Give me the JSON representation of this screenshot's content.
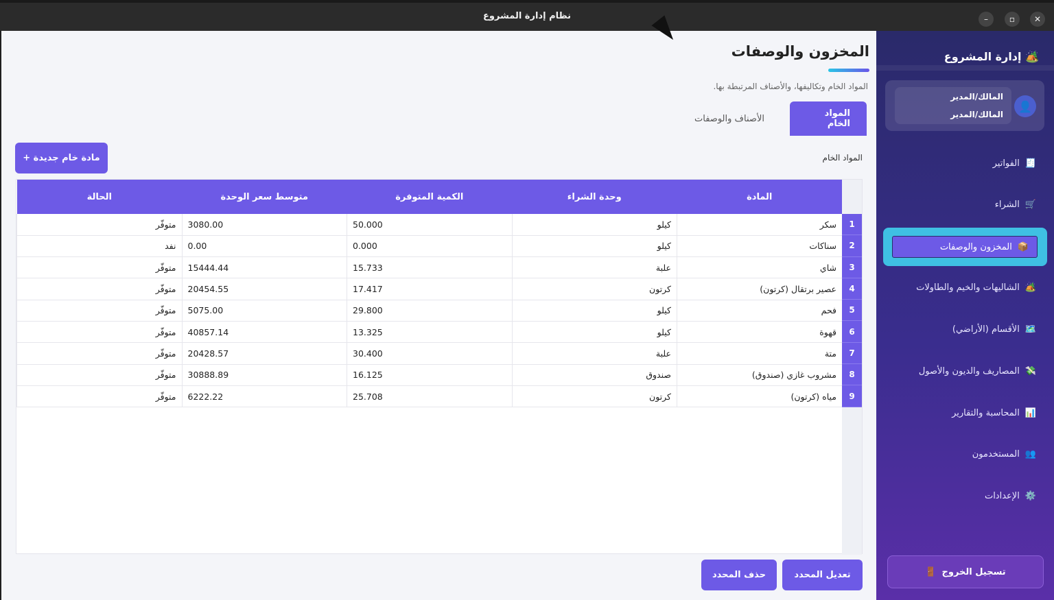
{
  "window": {
    "title": "نظام إدارة المشروع",
    "close": "✕",
    "maximize": "▫",
    "minimize": "–"
  },
  "page": {
    "title": "المخزون والوصفات",
    "subtitle": "المواد الخام وتكاليفها، والأصناف المرتبطة بها.",
    "tabs": [
      {
        "label": "المواد الخام",
        "active": true
      },
      {
        "label": "الأصناف والوصفات",
        "active": false
      }
    ],
    "section_label": "المواد الخام",
    "new_button": "مادة خام جديدة +",
    "edit_button": "تعديل المحدد",
    "delete_button": "حذف المحدد"
  },
  "table": {
    "headers": [
      "المادة",
      "وحدة الشراء",
      "الكمية المتوفرة",
      "متوسط سعر الوحدة",
      "الحالة"
    ],
    "rows": [
      {
        "index": "1",
        "name": "سكر",
        "unit": "كيلو",
        "qty": "50.000",
        "price": "3080.00",
        "status": "متوفّر"
      },
      {
        "index": "2",
        "name": "سناكات",
        "unit": "كيلو",
        "qty": "0.000",
        "price": "0.00",
        "status": "نفد"
      },
      {
        "index": "3",
        "name": "شاي",
        "unit": "علبة",
        "qty": "15.733",
        "price": "15444.44",
        "status": "متوفّر"
      },
      {
        "index": "4",
        "name": "عصير برتقال (كرتون)",
        "unit": "كرتون",
        "qty": "17.417",
        "price": "20454.55",
        "status": "متوفّر"
      },
      {
        "index": "5",
        "name": "فحم",
        "unit": "كيلو",
        "qty": "29.800",
        "price": "5075.00",
        "status": "متوفّر"
      },
      {
        "index": "6",
        "name": "قهوة",
        "unit": "كيلو",
        "qty": "13.325",
        "price": "40857.14",
        "status": "متوفّر"
      },
      {
        "index": "7",
        "name": "متة",
        "unit": "علبة",
        "qty": "30.400",
        "price": "20428.57",
        "status": "متوفّر"
      },
      {
        "index": "8",
        "name": "مشروب غازي (صندوق)",
        "unit": "صندوق",
        "qty": "16.125",
        "price": "30888.89",
        "status": "متوفّر"
      },
      {
        "index": "9",
        "name": "مياه (كرتون)",
        "unit": "كرتون",
        "qty": "25.708",
        "price": "6222.22",
        "status": "متوفّر"
      }
    ]
  },
  "sidebar": {
    "brand": "إدارة المشروع",
    "user_line1": "المالك/المدير",
    "user_line2": "المالك/المدير",
    "items": [
      {
        "label": "الفواتير",
        "icon": "receipt-icon",
        "active": false
      },
      {
        "label": "الشراء",
        "icon": "cart-icon",
        "active": false
      },
      {
        "label": "المخزون والوصفات",
        "icon": "box-icon",
        "active": true
      },
      {
        "label": "الشاليهات والخيم والطاولات",
        "icon": "tent-icon",
        "active": false
      },
      {
        "label": "الأقسام (الأراضي)",
        "icon": "map-icon",
        "active": false
      },
      {
        "label": "المصاريف والديون والأصول",
        "icon": "money-icon",
        "active": false
      },
      {
        "label": "المحاسبة والتقارير",
        "icon": "chart-icon",
        "active": false
      },
      {
        "label": "المستخدمون",
        "icon": "users-icon",
        "active": false
      },
      {
        "label": "الإعدادات",
        "icon": "gear-icon",
        "active": false
      }
    ],
    "logout": "تسجيل الخروج"
  },
  "colors": {
    "accent": "#6d5ae6",
    "active_nav": "#3fc0e3",
    "sidebar_top": "#2a2a6a",
    "sidebar_bottom": "#5a2fa8"
  }
}
